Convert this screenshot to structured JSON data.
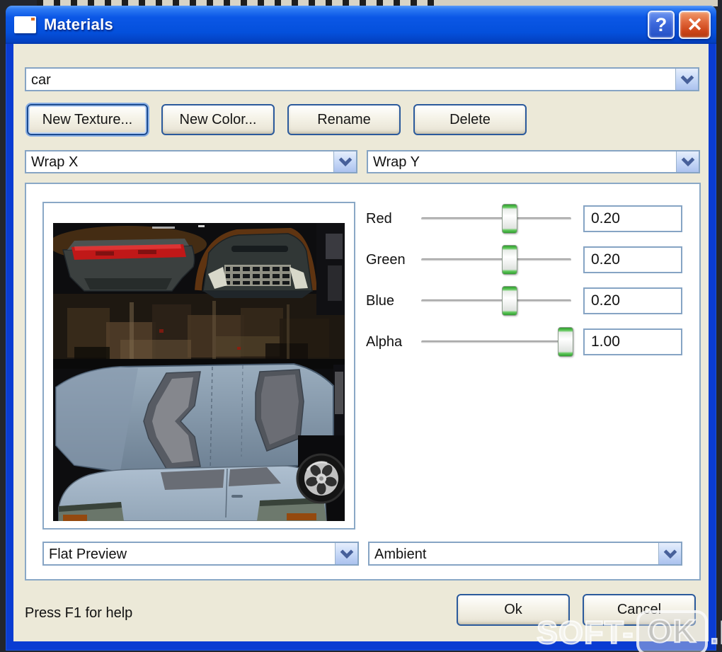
{
  "window": {
    "title": "Materials",
    "help_label": "?",
    "close_label": "✕"
  },
  "material_combo": {
    "value": "car"
  },
  "actions": {
    "new_texture": "New Texture...",
    "new_color": "New Color...",
    "rename": "Rename",
    "delete": "Delete"
  },
  "wrap_x_combo": {
    "value": "Wrap X"
  },
  "wrap_y_combo": {
    "value": "Wrap Y"
  },
  "sliders": [
    {
      "label": "Red",
      "value": "0.20",
      "position_pct": 59
    },
    {
      "label": "Green",
      "value": "0.20",
      "position_pct": 59
    },
    {
      "label": "Blue",
      "value": "0.20",
      "position_pct": 59
    },
    {
      "label": "Alpha",
      "value": "1.00",
      "position_pct": 96
    }
  ],
  "preview_combo": {
    "value": "Flat Preview"
  },
  "lighting_combo": {
    "value": "Ambient"
  },
  "footer": {
    "help_text": "Press F1 for help",
    "ok": "Ok",
    "cancel": "Cancel"
  },
  "watermark": {
    "prefix": "SOFT-",
    "boxed": "OK",
    "suffix": ".NET"
  },
  "colors": {
    "titlebar_blue": "#0b55e4",
    "window_frame_blue": "#0a3cd2",
    "dialog_bg": "#ece9d8",
    "close_button_red": "#d6552a",
    "help_button_blue": "#3c68dc",
    "control_border_blue": "#86a4c4",
    "button_border_blue": "#2b5a9c",
    "slider_thumb_green": "#2f9e2e",
    "taillight_red": "#c41a1a",
    "car_body_blue_gray": "#97aabb"
  }
}
